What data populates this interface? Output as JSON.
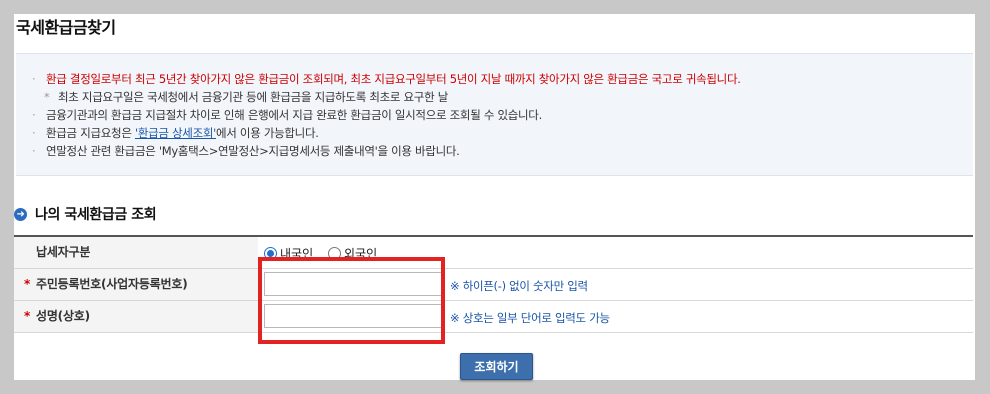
{
  "page": {
    "title": "국세환급금찾기"
  },
  "notice": {
    "items": [
      {
        "bullet": "·",
        "text": "환급 결정일로부터 최근 5년간 찾아가지 않은 환급금이 조회되며, 최초 지급요구일부터 5년이 지날 때까지 찾아가지 않은 환급금은 국고로 귀속됩니다."
      },
      {
        "bullet": "*",
        "text": "최초 지급요구일은 국세청에서 금융기관 등에 환급금을 지급하도록 최초로 요구한 날"
      },
      {
        "bullet": "·",
        "text": "금융기관과의 환급금 지급절차 차이로 인해 은행에서 지급 완료한 환급금이 일시적으로 조회될 수 있습니다."
      },
      {
        "bullet": "·",
        "before": "환급금 지급요청은 ",
        "link": "'환급금 상세조회'",
        "after": "에서 이용 가능합니다."
      },
      {
        "bullet": "·",
        "text": "연말정산 관련 환급금은 'My홈택스>연말정산>지급명세서등 제출내역'을 이용 바랍니다."
      }
    ]
  },
  "section": {
    "title": "나의 국세환급금 조회",
    "icon": "arrow-right-circle-icon"
  },
  "form": {
    "taxpayer_type": {
      "label": "납세자구분",
      "options": [
        "내국인",
        "외국인"
      ],
      "selected": "내국인"
    },
    "rrn": {
      "required_mark": "*",
      "label": "주민등록번호(사업자등록번호)",
      "value": "",
      "hint": "※ 하이픈(-) 없이 숫자만 입력"
    },
    "name": {
      "required_mark": "*",
      "label": "성명(상호)",
      "value": "",
      "hint": "※ 상호는 일부 단어로 입력도 가능"
    }
  },
  "actions": {
    "search_label": "조회하기"
  },
  "colors": {
    "highlight_box": "#e32222",
    "button": "#3d6fad",
    "link": "#1a56a8",
    "warning": "#cc0000"
  }
}
